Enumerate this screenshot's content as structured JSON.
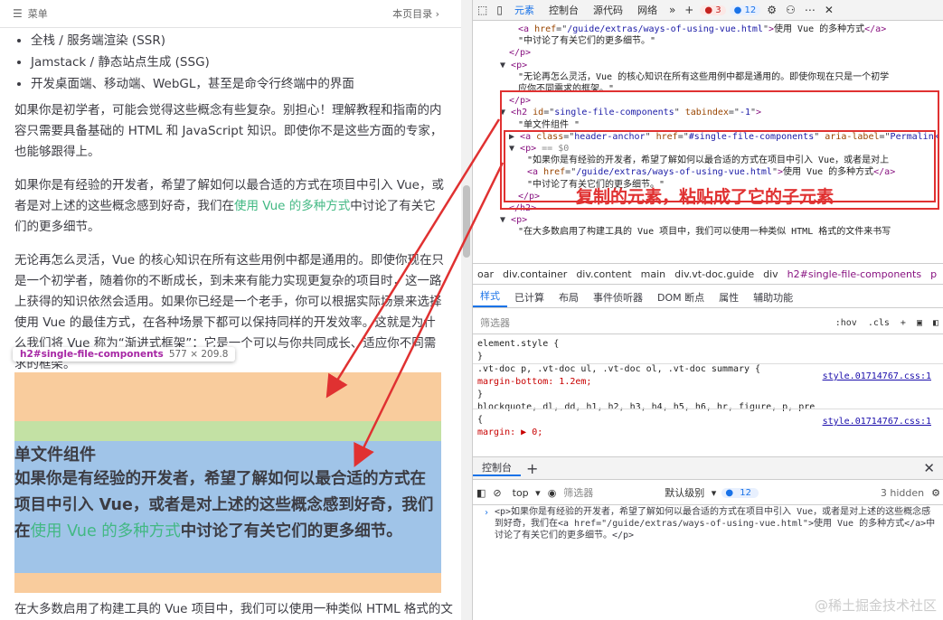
{
  "page": {
    "topbar": {
      "menu_label": "菜单",
      "toc_label": "本页目录",
      "menu_icon": "hamburger-icon",
      "toc_icon": "chevron-right-icon"
    },
    "bullets": [
      "全栈 / 服务端渲染 (SSR)",
      "Jamstack / 静态站点生成 (SSG)",
      "开发桌面端、移动端、WebGL，甚至是命令行终端中的界面"
    ],
    "para1": "如果你是初学者，可能会觉得这些概念有些复杂。别担心！理解教程和指南的内容只需要具备基础的 HTML 和 JavaScript 知识。即使你不是这些方面的专家，也能够跟得上。",
    "para2_before": "如果你是有经验的开发者，希望了解如何以最合适的方式在项目中引入 Vue，或者是对上述的这些概念感到好奇，我们在",
    "para2_link": "使用 Vue 的多种方式",
    "para2_after": "中讨论了有关它们的更多细节。",
    "para3": "无论再怎么灵活，Vue 的核心知识在所有这些用例中都是通用的。即使你现在只是一个初学者，随着你的不断成长，到未来有能力实现更复杂的项目时，这一路上获得的知识依然会适用。如果你已经是一个老手，你可以根据实际场景来选择使用 Vue 的最佳方式，在各种场景下都可以保持同样的开发效率。这就是为什么我们将 Vue 称为“渐进式框架”：它是一个可以与你共同成长、适应你不同需求的框架。",
    "tooltip": {
      "selector": "h2#single-file-components",
      "size": "577 × 209.8"
    },
    "h2_title": "单文件组件",
    "big_before": "如果你是有经验的开发者，希望了解如何以最合适的方式在项目中引入 Vue，或者是对上述的这些概念感到好奇，我们在",
    "big_link": "使用 Vue 的多种方式",
    "big_after": "中讨论了有关它们的更多细节。",
    "last_line": "在大多数启用了构建工具的 Vue 项目中，我们可以使用一种类似 HTML 格式的文"
  },
  "devtools": {
    "tabs": [
      "元素",
      "控制台",
      "源代码",
      "网络"
    ],
    "errors": "3",
    "messages": "12",
    "elements_lines": [
      {
        "indent": 5,
        "html": "<span class='tag'>&lt;a</span> <span class='attr'>href</span>=\"<span class='val'>/guide/extras/ways-of-using-vue.html</span>\"<span class='tag'>&gt;</span><span class='txt'>使用 Vue 的多种方式</span><span class='tag'>&lt;/a&gt;</span>"
      },
      {
        "indent": 5,
        "html": "<span class='txt'>\"中讨论了有关它们的更多细节。\"</span>"
      },
      {
        "indent": 4,
        "html": "<span class='tag'>&lt;/p&gt;</span>"
      },
      {
        "indent": 3,
        "html": "▼ <span class='tag'>&lt;p&gt;</span>"
      },
      {
        "indent": 5,
        "html": "<span class='txt'>\"无论再怎么灵活，Vue 的核心知识在所有这些用例中都是通用的。即使你现在只是一个初学</span>"
      },
      {
        "indent": 5,
        "html": "<span class='txt'>应你不同需求的框架。\"</span>"
      },
      {
        "indent": 4,
        "html": "<span class='tag'>&lt;/p&gt;</span>"
      },
      {
        "indent": 3,
        "html": "▼ <span class='tag'>&lt;h2</span> <span class='attr'>id</span>=\"<span class='val'>single-file-components</span>\" <span class='attr'>tabindex</span>=\"<span class='val'>-1</span>\"<span class='tag'>&gt;</span>"
      },
      {
        "indent": 5,
        "html": "<span class='txt'>\"单文件组件 \"</span>"
      },
      {
        "indent": 4,
        "html": "▶ <span class='tag'>&lt;a</span> <span class='attr'>class</span>=\"<span class='val'>header-anchor</span>\" <span class='attr'>href</span>=\"<span class='val'>#single-file-components</span>\" <span class='attr'>aria-label</span>=\"<span class='val'>Permalink</span>"
      },
      {
        "indent": 4,
        "html": "▼ <span class='tag'>&lt;p&gt;</span> <span class='cmt'>== $0</span>"
      },
      {
        "indent": 6,
        "html": "<span class='txt'>\"如果你是有经验的开发者，希望了解如何以最合适的方式在项目中引入 Vue，或者是对上</span>"
      },
      {
        "indent": 6,
        "html": "<span class='tag'>&lt;a</span> <span class='attr'>href</span>=\"<span class='val'>/guide/extras/ways-of-using-vue.html</span>\"<span class='tag'>&gt;</span><span class='txt'>使用 Vue 的多种方式</span><span class='tag'>&lt;/a&gt;</span>"
      },
      {
        "indent": 6,
        "html": "<span class='txt'>\"中讨论了有关它们的更多细节。\"</span>"
      },
      {
        "indent": 5,
        "html": "<span class='tag'>&lt;/p&gt;</span>"
      },
      {
        "indent": 4,
        "html": "<span class='tag'>&lt;/h2&gt;</span>"
      },
      {
        "indent": 3,
        "html": "▼ <span class='tag'>&lt;p&gt;</span>"
      },
      {
        "indent": 5,
        "html": "<span class='txt'>\"在大多数启用了构建工具的 Vue 项目中，我们可以使用一种类似 HTML 格式的文件来书写</span>"
      }
    ],
    "annotation": "复制的元素，粘贴成了它的子元素",
    "breadcrumbs": [
      "oar",
      "div.container",
      "div.content",
      "main",
      "div.vt-doc.guide",
      "div",
      "h2#single-file-components",
      "p"
    ],
    "style_tabs": [
      "样式",
      "已计算",
      "布局",
      "事件侦听器",
      "DOM 断点",
      "属性",
      "辅助功能"
    ],
    "filter_placeholder": "筛选器",
    "hov": ":hov",
    "cls": ".cls",
    "styles_lines": [
      "element.style {",
      "}",
      ".vt-doc p, .vt-doc ul, .vt-doc ol, .vt-doc summary {",
      "  margin-bottom: 1.2em;",
      "}",
      "blockquote, dl, dd, h1, h2, h3, h4, h5, h6, hr, figure, p, pre",
      "{",
      "  margin: ▶ 0;"
    ],
    "style_source": "style.01714767.css:1",
    "console_tab": "控制台",
    "console_context": "top",
    "console_filter": "筛选器",
    "console_level": "默认级别",
    "console_badge": "12",
    "hidden_count": "3 hidden",
    "console_output": "<p>如果你是有经验的开发者，希望了解如何以最合适的方式在项目中引入 Vue，或者是对上述的这些概念感到好奇，我们在<a href=\"/guide/extras/ways-of-using-vue.html\">使用 Vue 的多种方式</a>中讨论了有关它们的更多细节。</p>"
  },
  "watermark": "@稀土掘金技术社区",
  "colors": {
    "accent": "#1a73e8",
    "annotation": "#e03131",
    "vue_green": "#42b883"
  }
}
